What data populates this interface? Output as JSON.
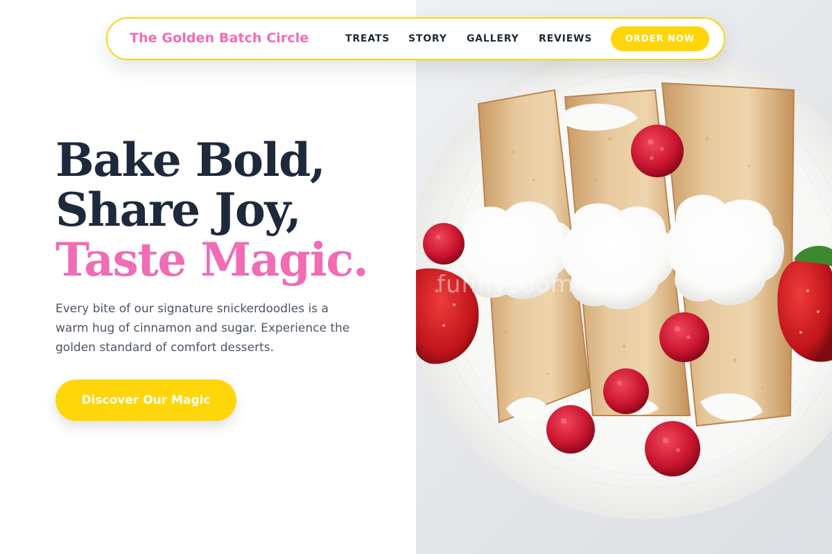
{
  "navbar": {
    "brand": "The Golden Batch Circle",
    "links": [
      "TREATS",
      "STORY",
      "GALLERY",
      "REVIEWS"
    ],
    "cta_label": "ORDER NOW"
  },
  "hero": {
    "headline_line1": "Bake Bold,",
    "headline_line2": "Share Joy,",
    "headline_line3": "Taste Magic.",
    "body": "Every bite of our signature snickerdoodles is a warm hug of cinnamon and sugar. Experience the golden standard of comfort desserts.",
    "cta_label": "Discover Our Magic"
  },
  "image": {
    "watermark": "funnysoome.xyz",
    "subject": "crepes-with-whipped-cream-and-berries"
  },
  "colors": {
    "accent_pink": "#f06cb4",
    "accent_yellow": "#ffd60a",
    "heading_dark": "#1e293b",
    "body_gray": "#4b5563"
  }
}
